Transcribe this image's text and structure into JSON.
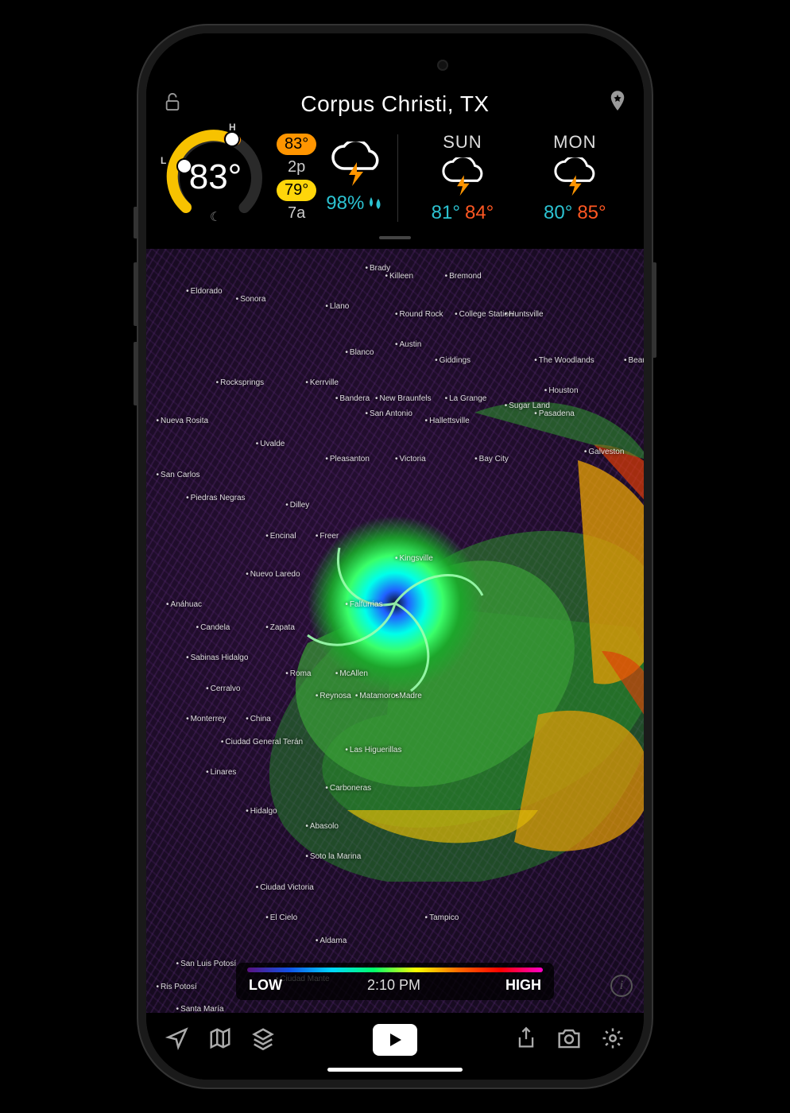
{
  "location": "Corpus Christi, TX",
  "dial": {
    "temp": "83°",
    "low_marker": "L",
    "high_marker": "H"
  },
  "high_low": {
    "high_temp": "83°",
    "high_time": "2p",
    "low_temp": "79°",
    "low_time": "7a"
  },
  "precip": "98%",
  "forecast": [
    {
      "day": "SUN",
      "lo": "81°",
      "hi": "84°"
    },
    {
      "day": "MON",
      "lo": "80°",
      "hi": "85°"
    }
  ],
  "scale": {
    "low": "LOW",
    "time": "2:10 PM",
    "high": "HIGH"
  },
  "map_cities": [
    "Brady",
    "Killeen",
    "Bremond",
    "Eldorado",
    "Sonora",
    "Llano",
    "Round Rock",
    "College Station",
    "Huntsville",
    "Austin",
    "Blanco",
    "Giddings",
    "The Woodlands",
    "Beaumont",
    "Rocksprings",
    "Kerrville",
    "Bandera",
    "New Braunfels",
    "La Grange",
    "Houston",
    "Sugar Land",
    "Pasadena",
    "Nueva Rosita",
    "San Antonio",
    "Hallettsville",
    "Uvalde",
    "Pleasanton",
    "Victoria",
    "Bay City",
    "Galveston",
    "San Carlos",
    "Piedras Negras",
    "Dilley",
    "Encinal",
    "Freer",
    "Nuevo Laredo",
    "Kingsville",
    "Anáhuac",
    "Falfurrias",
    "Candela",
    "Zapata",
    "Sabinas Hidalgo",
    "Roma",
    "McAllen",
    "Cerralvo",
    "Reynosa",
    "Matamoros",
    "Madre",
    "Monterrey",
    "China",
    "Ciudad General Terán",
    "Las Higuerillas",
    "Linares",
    "Carboneras",
    "Hidalgo",
    "Abasolo",
    "Soto la Marina",
    "Ciudad Victoria",
    "Tampico",
    "El Cielo",
    "Aldama",
    "San Luis Potosí",
    "Ciudad Mante",
    "Ris Potosí",
    "Santa María"
  ]
}
